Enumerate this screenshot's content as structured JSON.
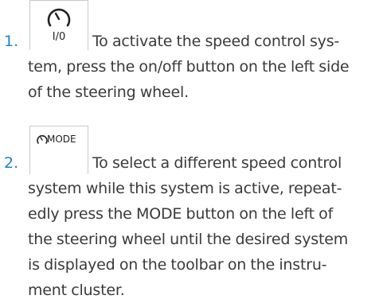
{
  "steps": [
    {
      "number": "1.",
      "icon": "speed-control-on-off-icon",
      "icon_label": "I/0",
      "lines": [
        "To activate the speed control sys-",
        "tem, press the on/off button on the left side",
        "of the steering wheel."
      ]
    },
    {
      "number": "2.",
      "icon": "mode-button-icon",
      "icon_label": "MODE",
      "lines": [
        "To select a different speed control",
        "system while this system is active, repeat-",
        "edly press the MODE button on the left of",
        "the steering wheel until the desired system",
        "is displayed on the toolbar on the instru-",
        "ment cluster."
      ]
    }
  ],
  "colors": {
    "step_number": "#1d84c6",
    "body_text": "#3a3a3a"
  }
}
